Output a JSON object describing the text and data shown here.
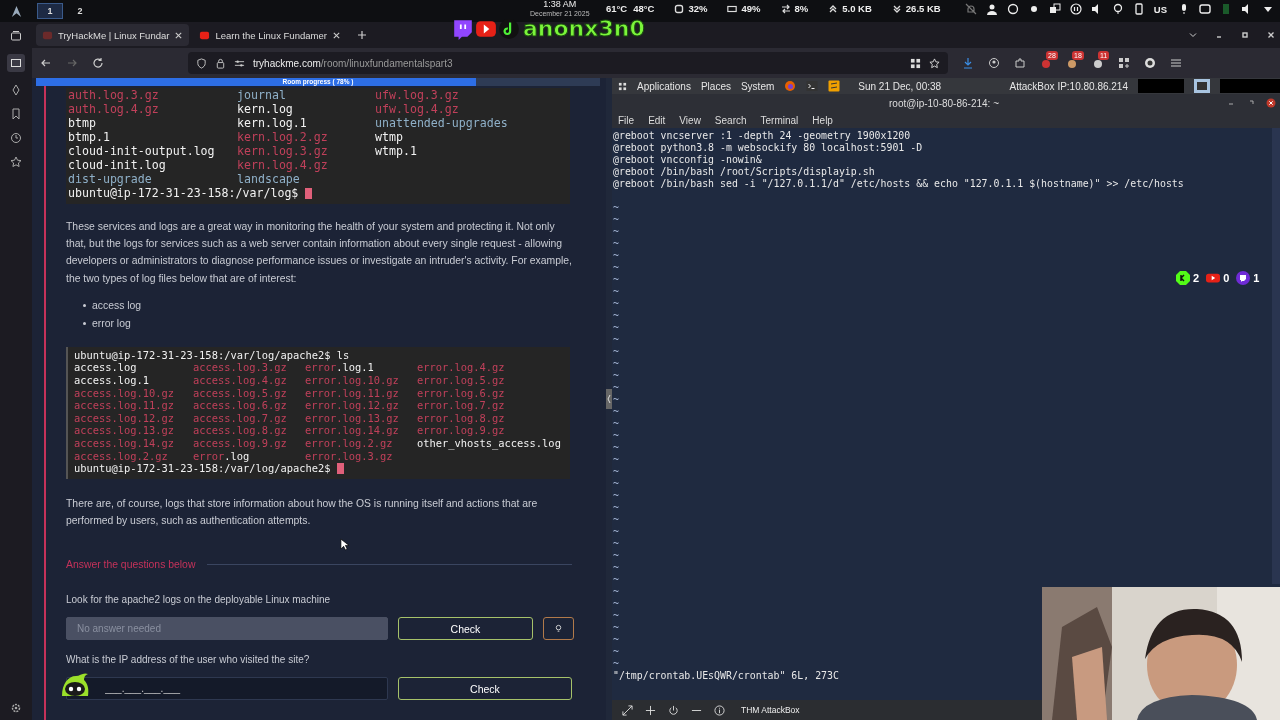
{
  "topbar": {
    "workspaces": [
      {
        "label": "1",
        "selected": true
      },
      {
        "label": "2",
        "selected": false
      }
    ],
    "clock": {
      "time": "1:38 AM",
      "date": "December 21 2025"
    },
    "overlay_handle": "anonx3n0",
    "stats": [
      {
        "kind": "temp",
        "text": "61°C"
      },
      {
        "kind": "temp",
        "text": "48°C"
      },
      {
        "kind": "cpu",
        "text": "32%"
      },
      {
        "kind": "ram",
        "text": "49%"
      },
      {
        "kind": "swap",
        "text": "8%"
      },
      {
        "kind": "up",
        "text": "5.0 KB"
      },
      {
        "kind": "down",
        "text": "26.5 KB"
      }
    ],
    "keyboard": "US"
  },
  "browser": {
    "tabs": [
      {
        "title": "TryHackMe | Linux Fundar",
        "selected": true
      },
      {
        "title": "Learn the Linux Fundamer",
        "selected": false
      }
    ],
    "url": {
      "host": "tryhackme.com",
      "path": "/room/linuxfundamentalspart3"
    },
    "extension_badges": [
      "28",
      "18",
      "11"
    ]
  },
  "room": {
    "progress": {
      "label": "Room progress ( 78% )",
      "level": 0.78
    },
    "terminal_1": {
      "rows": [
        [
          {
            "text": "auth.log.3.gz",
            "kind": "archive"
          },
          {
            "text": "journal",
            "kind": "dir"
          },
          {
            "text": "ufw.log.3.gz",
            "kind": "archive"
          }
        ],
        [
          {
            "text": "auth.log.4.gz",
            "kind": "archive"
          },
          {
            "text": "kern.log",
            "kind": "file"
          },
          {
            "text": "ufw.log.4.gz",
            "kind": "archive"
          }
        ],
        [
          {
            "text": "btmp",
            "kind": "file"
          },
          {
            "text": "kern.log.1",
            "kind": "file"
          },
          {
            "text": "unattended-upgrades",
            "kind": "dir"
          }
        ],
        [
          {
            "text": "btmp.1",
            "kind": "file"
          },
          {
            "text": "kern.log.2.gz",
            "kind": "archive"
          },
          {
            "text": "wtmp",
            "kind": "file"
          }
        ],
        [
          {
            "text": "cloud-init-output.log",
            "kind": "file"
          },
          {
            "text": "kern.log.3.gz",
            "kind": "archive"
          },
          {
            "text": "wtmp.1",
            "kind": "file"
          }
        ],
        [
          {
            "text": "cloud-init.log",
            "kind": "file"
          },
          {
            "text": "kern.log.4.gz",
            "kind": "archive"
          }
        ],
        [
          {
            "text": "dist-upgrade",
            "kind": "dir"
          },
          {
            "text": "landscape",
            "kind": "dir"
          }
        ]
      ],
      "prompt": "ubuntu@ip-172-31-23-158:/var/log$"
    },
    "paragraph_1": "These services and logs are a great way in monitoring the health of your system and protecting it. Not only that, but the logs for services such as a web server contain information about every single request - allowing developers or administrators to diagnose performance issues or investigate an intruder's activity. For example, the two types of log files below that are of interest:",
    "bullets": [
      "access log",
      "error log"
    ],
    "terminal_2": {
      "command": "ubuntu@ip-172-31-23-158:/var/log/apache2$ ls",
      "rows": [
        [
          {
            "text": "access.log",
            "kind": "file"
          },
          {
            "text": "access.log.3.gz",
            "kind": "archive"
          },
          {
            "head": "error",
            "text": ".log.1",
            "kind": "file"
          },
          {
            "text": "error.log.4.gz",
            "kind": "archive"
          }
        ],
        [
          {
            "text": "access.log.1",
            "kind": "file"
          },
          {
            "text": "access.log.4.gz",
            "kind": "archive"
          },
          {
            "text": "error.log.10.gz",
            "kind": "archive"
          },
          {
            "text": "error.log.5.gz",
            "kind": "archive"
          }
        ],
        [
          {
            "text": "access.log.10.gz",
            "kind": "archive"
          },
          {
            "text": "access.log.5.gz",
            "kind": "archive"
          },
          {
            "text": "error.log.11.gz",
            "kind": "archive"
          },
          {
            "text": "error.log.6.gz",
            "kind": "archive"
          }
        ],
        [
          {
            "text": "access.log.11.gz",
            "kind": "archive"
          },
          {
            "text": "access.log.6.gz",
            "kind": "archive"
          },
          {
            "text": "error.log.12.gz",
            "kind": "archive"
          },
          {
            "text": "error.log.7.gz",
            "kind": "archive"
          }
        ],
        [
          {
            "text": "access.log.12.gz",
            "kind": "archive"
          },
          {
            "text": "access.log.7.gz",
            "kind": "archive"
          },
          {
            "text": "error.log.13.gz",
            "kind": "archive"
          },
          {
            "text": "error.log.8.gz",
            "kind": "archive"
          }
        ],
        [
          {
            "text": "access.log.13.gz",
            "kind": "archive"
          },
          {
            "text": "access.log.8.gz",
            "kind": "archive"
          },
          {
            "text": "error.log.14.gz",
            "kind": "archive"
          },
          {
            "text": "error.log.9.gz",
            "kind": "archive"
          }
        ],
        [
          {
            "text": "access.log.14.gz",
            "kind": "archive"
          },
          {
            "text": "access.log.9.gz",
            "kind": "archive"
          },
          {
            "text": "error.log.2.gz",
            "kind": "archive"
          },
          {
            "text": "other_vhosts_access.log",
            "kind": "file"
          }
        ],
        [
          {
            "text": "access.log.2.gz",
            "kind": "archive"
          },
          {
            "head": "error",
            "text": ".log",
            "kind": "file"
          },
          {
            "text": "error.log.3.gz",
            "kind": "archive"
          }
        ]
      ],
      "prompt": "ubuntu@ip-172-31-23-158:/var/log/apache2$"
    },
    "paragraph_2": "There are, of course, logs that store information about how the OS is running itself and actions that are performed by users, such as authentication attempts.",
    "answers": {
      "heading": "Answer the questions below",
      "questions": [
        {
          "text": "Look for the apache2 logs on the deployable Linux machine",
          "placeholder": "No answer needed",
          "disabled": true,
          "button": "Check",
          "hint": true
        },
        {
          "text": "What is the IP address of the user who visited the site?",
          "placeholder": "___.___.___.___",
          "disabled": false,
          "button": "Check",
          "hint": false
        }
      ]
    }
  },
  "attackbox": {
    "panel": {
      "menus": [
        "Applications",
        "Places",
        "System"
      ],
      "datetime": "Sun 21 Dec, 00:38",
      "ip": "AttackBox IP:10.80.86.214"
    },
    "window_title": "root@ip-10-80-86-214: ~",
    "menu": [
      "File",
      "Edit",
      "View",
      "Search",
      "Terminal",
      "Help"
    ],
    "lines": [
      "@reboot vncserver :1 -depth 24 -geometry 1900x1200",
      "@reboot python3.8 -m websockify 80 localhost:5901 -D",
      "@reboot vncconfig -nowin&",
      "@reboot /bin/bash /root/Scripts/displayip.sh",
      "@reboot /bin/bash sed -i \"/127.0.1.1/d\" /etc/hosts && echo \"127.0.1.1 $(hostname)\" >> /etc/hosts"
    ],
    "filler": [
      "~",
      "~",
      "~",
      "~",
      "~",
      "~",
      "~",
      "~",
      "~",
      "~",
      "~",
      "~",
      "~",
      "~",
      "~",
      "~",
      "~",
      "~",
      "~",
      "~",
      "~",
      "~",
      "~",
      "~",
      "~",
      "~",
      "~",
      "~",
      "~",
      "~",
      "~",
      "~",
      "~",
      "~",
      "~",
      "~",
      "~",
      "~",
      "~"
    ],
    "status_line": "\"/tmp/crontab.UEsQWR/crontab\" 6L, 273C",
    "toolbar_label": "THM AttackBox"
  },
  "stream_counters": [
    {
      "kind": "kick",
      "count": "2"
    },
    {
      "kind": "youtube",
      "count": "0"
    },
    {
      "kind": "twitch",
      "count": "1"
    }
  ]
}
